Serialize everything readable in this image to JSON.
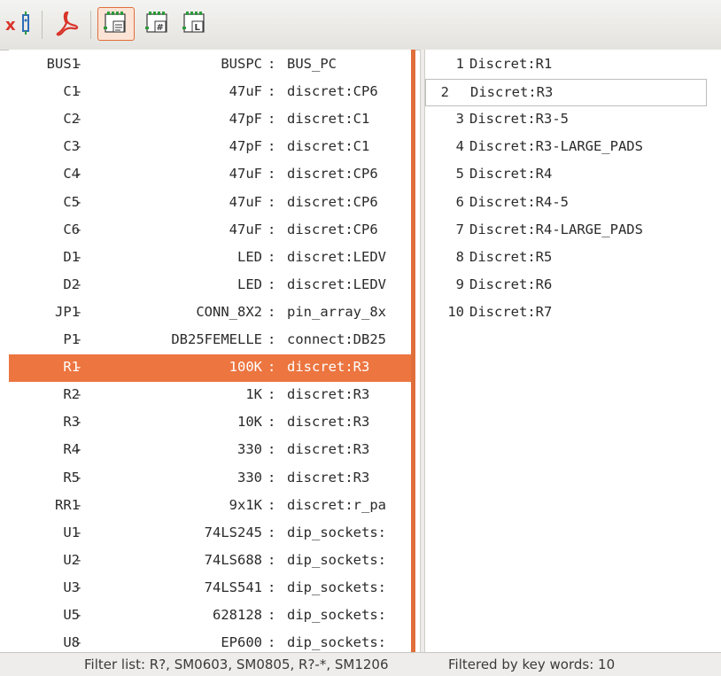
{
  "toolbar": {
    "buttons": [
      {
        "icon": "export-netlist-icon"
      },
      {
        "icon": "pdf-icon"
      },
      {
        "icon": "filter-by-keywords-icon",
        "active": true
      },
      {
        "icon": "filter-by-pin-count-icon"
      },
      {
        "icon": "filter-by-library-icon"
      }
    ]
  },
  "components": [
    {
      "ref": "BUS1",
      "dash": "-",
      "value": "BUSPC",
      "colon": ":",
      "footprint": "BUS_PC"
    },
    {
      "ref": "C1",
      "dash": "-",
      "value": "47uF",
      "colon": ":",
      "footprint": "discret:CP6"
    },
    {
      "ref": "C2",
      "dash": "-",
      "value": "47pF",
      "colon": ":",
      "footprint": "discret:C1"
    },
    {
      "ref": "C3",
      "dash": "-",
      "value": "47pF",
      "colon": ":",
      "footprint": "discret:C1"
    },
    {
      "ref": "C4",
      "dash": "-",
      "value": "47uF",
      "colon": ":",
      "footprint": "discret:CP6"
    },
    {
      "ref": "C5",
      "dash": "-",
      "value": "47uF",
      "colon": ":",
      "footprint": "discret:CP6"
    },
    {
      "ref": "C6",
      "dash": "-",
      "value": "47uF",
      "colon": ":",
      "footprint": "discret:CP6"
    },
    {
      "ref": "D1",
      "dash": "-",
      "value": "LED",
      "colon": ":",
      "footprint": "discret:LEDV"
    },
    {
      "ref": "D2",
      "dash": "-",
      "value": "LED",
      "colon": ":",
      "footprint": "discret:LEDV"
    },
    {
      "ref": "JP1",
      "dash": "-",
      "value": "CONN_8X2",
      "colon": ":",
      "footprint": "pin_array_8x"
    },
    {
      "ref": "P1",
      "dash": "-",
      "value": "DB25FEMELLE",
      "colon": ":",
      "footprint": "connect:DB25"
    },
    {
      "ref": "R1",
      "dash": "-",
      "value": "100K",
      "colon": ":",
      "footprint": "discret:R3",
      "selected": true
    },
    {
      "ref": "R2",
      "dash": "-",
      "value": "1K",
      "colon": ":",
      "footprint": "discret:R3"
    },
    {
      "ref": "R3",
      "dash": "-",
      "value": "10K",
      "colon": ":",
      "footprint": "discret:R3"
    },
    {
      "ref": "R4",
      "dash": "-",
      "value": "330",
      "colon": ":",
      "footprint": "discret:R3"
    },
    {
      "ref": "R5",
      "dash": "-",
      "value": "330",
      "colon": ":",
      "footprint": "discret:R3"
    },
    {
      "ref": "RR1",
      "dash": "-",
      "value": "9x1K",
      "colon": ":",
      "footprint": "discret:r_pa"
    },
    {
      "ref": "U1",
      "dash": "-",
      "value": "74LS245",
      "colon": ":",
      "footprint": "dip_sockets:"
    },
    {
      "ref": "U2",
      "dash": "-",
      "value": "74LS688",
      "colon": ":",
      "footprint": "dip_sockets:"
    },
    {
      "ref": "U3",
      "dash": "-",
      "value": "74LS541",
      "colon": ":",
      "footprint": "dip_sockets:"
    },
    {
      "ref": "U5",
      "dash": "-",
      "value": "628128",
      "colon": ":",
      "footprint": "dip_sockets:"
    },
    {
      "ref": "U8",
      "dash": "-",
      "value": "EP600",
      "colon": ":",
      "footprint": "dip_sockets:"
    }
  ],
  "footprints": [
    {
      "num": "1",
      "name": "Discret:R1"
    },
    {
      "num": "2",
      "name": "Discret:R3",
      "focused": true
    },
    {
      "num": "3",
      "name": "Discret:R3-5"
    },
    {
      "num": "4",
      "name": "Discret:R3-LARGE_PADS"
    },
    {
      "num": "5",
      "name": "Discret:R4"
    },
    {
      "num": "6",
      "name": "Discret:R4-5"
    },
    {
      "num": "7",
      "name": "Discret:R4-LARGE_PADS"
    },
    {
      "num": "8",
      "name": "Discret:R5"
    },
    {
      "num": "9",
      "name": "Discret:R6"
    },
    {
      "num": "10",
      "name": "Discret:R7"
    }
  ],
  "status": {
    "filter_list": "Filter list: R?, SM0603, SM0805, R?-*, SM1206",
    "filtered": "Filtered by key words: 10"
  },
  "colors": {
    "accent": "#ec7540",
    "scrollbar": "#e06e3a"
  }
}
